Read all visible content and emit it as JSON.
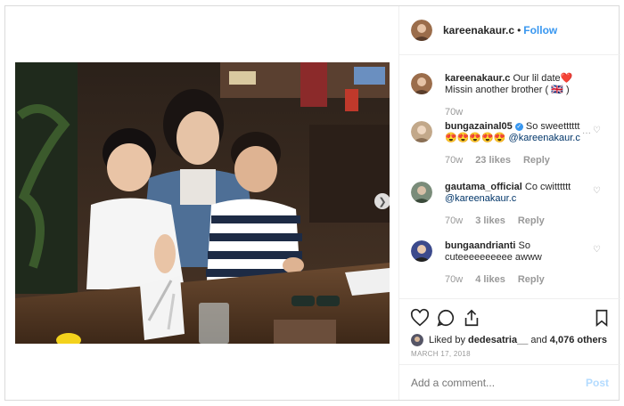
{
  "header": {
    "username": "kareenakaur.c",
    "separator": "•",
    "follow_label": "Follow"
  },
  "caption": {
    "username": "kareenakaur.c",
    "text_line1": "Our lil date",
    "emoji_heart": "❤️",
    "text_line2": "Missin another brother (",
    "emoji_flag": "🇬🇧",
    "text_line2_end": ")",
    "time": "70w"
  },
  "comments": [
    {
      "username": "bungazainal05",
      "verified": true,
      "text": "So sweetttttt",
      "emojis": "😍😍😍😍😍",
      "mention": "@kareenakaur.c",
      "time": "70w",
      "likes": "23 likes",
      "reply_label": "Reply",
      "more": "···"
    },
    {
      "username": "gautama_official",
      "text": "Co cwitttttt",
      "mention": "@kareenakaur.c",
      "time": "70w",
      "likes": "3 likes",
      "reply_label": "Reply"
    },
    {
      "username": "bungaandrianti",
      "text_line1": "So",
      "text_line2": "cuteeeeeeeeee awww",
      "time": "70w",
      "likes": "4 likes",
      "reply_label": "Reply"
    }
  ],
  "actions": {
    "liked_prefix": "Liked by",
    "liked_user": "dedesatria__",
    "liked_suffix": "and",
    "liked_count": "4,076 others",
    "date": "MARCH 17, 2018"
  },
  "add_comment": {
    "placeholder": "Add a comment...",
    "post_label": "Post"
  },
  "colors": {
    "accent": "#3897f0",
    "muted": "#999999",
    "border": "#dbdbdb",
    "post_disabled": "#b3dbff"
  }
}
